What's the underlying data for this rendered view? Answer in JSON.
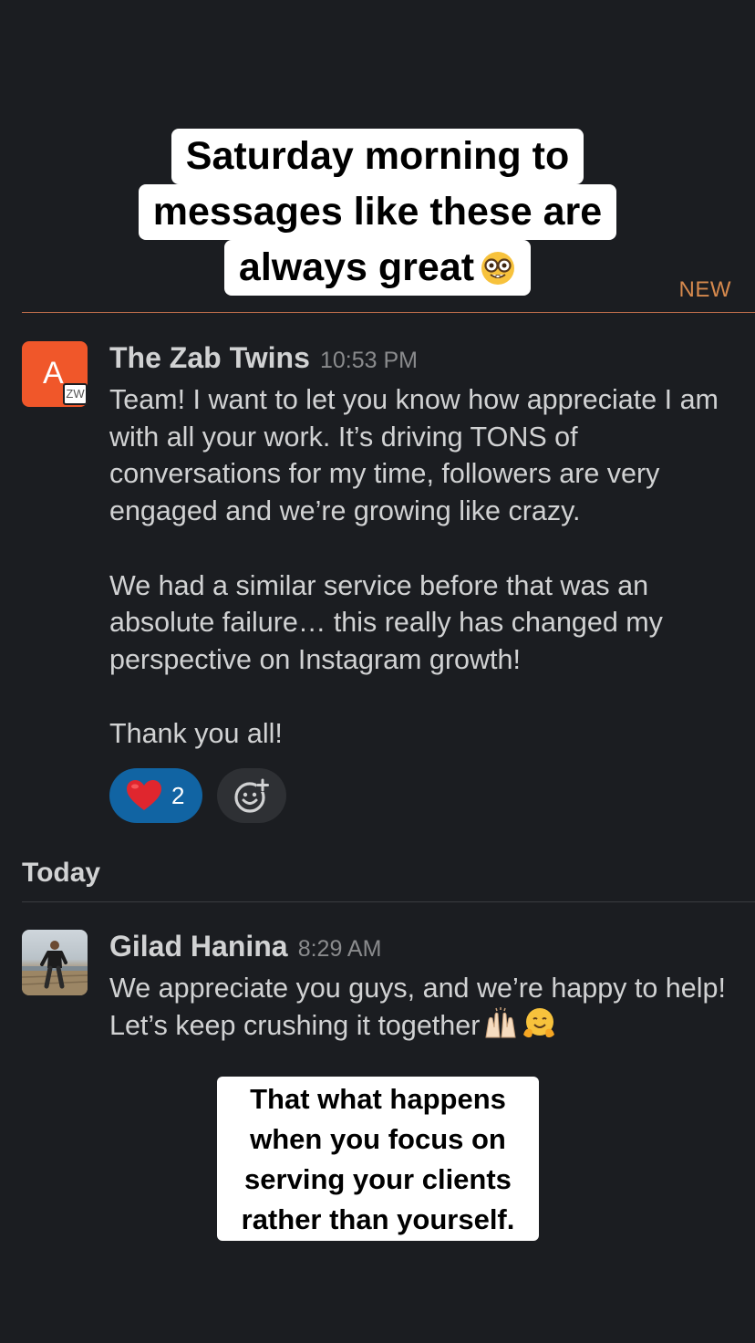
{
  "story": {
    "top_caption": {
      "lines": [
        "Saturday morning to",
        "messages like these are",
        "always great"
      ],
      "emoji": "nerd-face-icon"
    },
    "bottom_caption": {
      "lines": [
        "That what happens",
        "when you focus on",
        "serving your clients",
        "rather than yourself."
      ]
    }
  },
  "channel": {
    "new_label": "NEW",
    "day_label": "Today"
  },
  "messages": [
    {
      "sender": "The Zab Twins",
      "time": "10:53 PM",
      "avatar": {
        "letter": "A",
        "badge": "ZW",
        "color": "#f0572a"
      },
      "paragraphs": [
        "Team! I want to let you know how appreciate I am with all your work. It’s driving TONS of conversations for my time, followers are very engaged and we’re growing like crazy.",
        "We had a similar service before that was an absolute failure… this really has changed my perspective on Instagram growth!",
        "Thank you all!"
      ],
      "reactions": [
        {
          "emoji": "red-heart-icon",
          "count": "2"
        }
      ]
    },
    {
      "sender": "Gilad Hanina",
      "time": "8:29 AM",
      "avatar": {
        "type": "photo"
      },
      "text": "We appreciate you guys, and we’re happy to help! Let’s keep crushing it together",
      "trailing_emojis": [
        "raising-hands-icon",
        "hugging-face-icon"
      ]
    }
  ],
  "colors": {
    "background": "#1b1d21",
    "new_divider": "#b86a4a",
    "new_label": "#d6894d",
    "reaction_active": "#1164a3",
    "reaction_inactive": "#2e3034"
  }
}
